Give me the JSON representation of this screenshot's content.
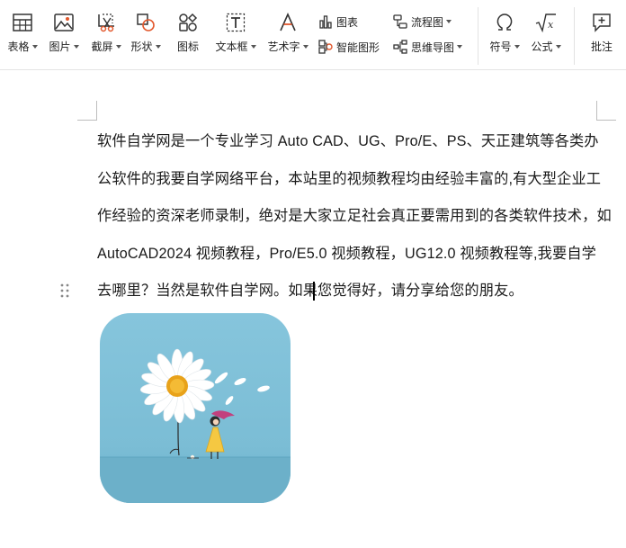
{
  "ribbon": {
    "large_buttons": [
      {
        "key": "table",
        "label": "表格",
        "icon": "table-icon",
        "dropdown": true
      },
      {
        "key": "picture",
        "label": "图片",
        "icon": "image-icon",
        "dropdown": true
      },
      {
        "key": "screenshot",
        "label": "截屏",
        "icon": "scissors-icon",
        "dropdown": true
      },
      {
        "key": "shape",
        "label": "形状",
        "icon": "shapes-icon",
        "dropdown": true
      },
      {
        "key": "icons",
        "label": "图标",
        "icon": "icon-library-icon",
        "dropdown": false
      },
      {
        "key": "textbox",
        "label": "文本框",
        "icon": "textbox-icon",
        "dropdown": true
      },
      {
        "key": "wordart",
        "label": "艺术字",
        "icon": "wordart-icon",
        "dropdown": true
      },
      {
        "key": "symbol",
        "label": "符号",
        "icon": "omega-icon",
        "dropdown": true
      },
      {
        "key": "formula",
        "label": "公式",
        "icon": "sqrt-icon",
        "dropdown": true
      },
      {
        "key": "comment",
        "label": "批注",
        "icon": "add-comment-icon",
        "dropdown": false
      }
    ],
    "small_buttons": [
      {
        "key": "chart",
        "label": "图表",
        "icon": "bar-chart-icon",
        "dropdown": false
      },
      {
        "key": "smartart",
        "label": "智能图形",
        "icon": "smart-graphic-icon",
        "dropdown": false
      },
      {
        "key": "flowchart",
        "label": "流程图",
        "icon": "flowchart-icon",
        "dropdown": true
      },
      {
        "key": "mindmap",
        "label": "思维导图",
        "icon": "mindmap-icon",
        "dropdown": true
      }
    ]
  },
  "document": {
    "lines": [
      "软件自学网是一个专业学习 Auto CAD、UG、Pro/E、PS、天正建筑等各类办",
      "公软件的我要自学网络平台，本站里的视频教程均由经验丰富的,有大型企业工",
      "作经验的资深老师录制，绝对是大家立足社会真正要需用到的各类软件技术，如",
      "AutoCAD2024 视频教程，Pro/E5.0 视频教程，UG12.0 视频教程等,我要自学",
      "去哪里？当然是软件自学网。如果您觉得好，请分享给您的朋友。"
    ],
    "image": {
      "description_icon": "daisy-girl-illustration",
      "colors": {
        "background": "#7fc0d8",
        "ground": "#6cb3cc",
        "petal": "#ffffff",
        "center": "#f2b01e",
        "dress": "#f5c842"
      }
    }
  },
  "colors": {
    "ribbon_bg": "#ffffff",
    "text": "#1a1a1a",
    "border": "#e4e4e4",
    "icon": "#333333"
  }
}
